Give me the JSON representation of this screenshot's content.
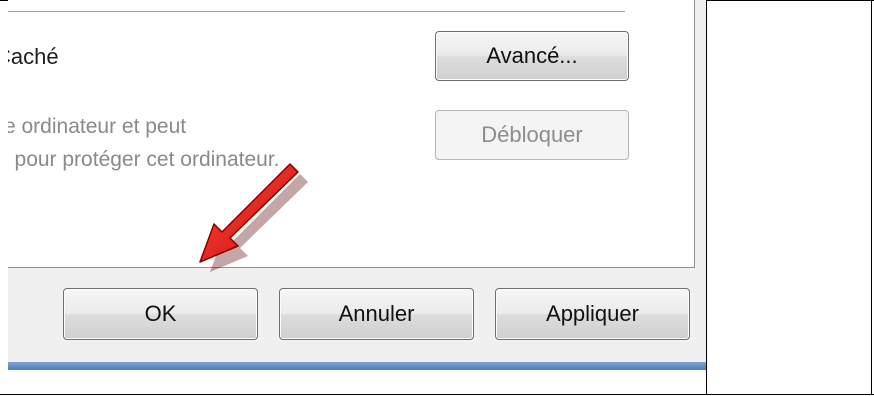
{
  "dialog": {
    "cache_label": "Caché",
    "description_lines": [
      "re ordinateur et peut",
      "é pour protéger cet ordinateur."
    ],
    "buttons": {
      "advanced": "Avancé...",
      "unblock": "Débloquer",
      "ok": "OK",
      "cancel": "Annuler",
      "apply": "Appliquer"
    }
  },
  "annotation": {
    "arrow_color": "#e01010",
    "arrow_target": "ok-button"
  },
  "colors": {
    "window_bg": "#f0f0f0",
    "panel_bg": "#ffffff",
    "accent_bar": "#4a7fbd"
  }
}
